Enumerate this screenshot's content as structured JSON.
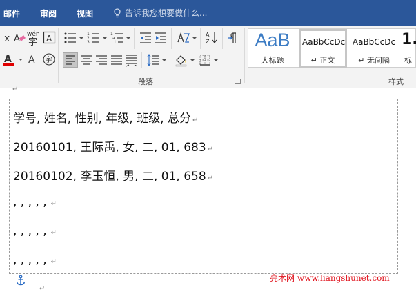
{
  "tabs": [
    {
      "label": "邮件"
    },
    {
      "label": "审阅"
    },
    {
      "label": "视图"
    }
  ],
  "tellme": {
    "placeholder": "告诉我您想要做什么..."
  },
  "ribbon": {
    "paragraph_group_label": "段落",
    "styles_group_label": "样式",
    "wen_glyph": "wén",
    "zi_glyph": "字",
    "A_glyph": "A",
    "az_glyph": "A↓Z"
  },
  "styles": [
    {
      "sample": "AaB",
      "name": "大标题"
    },
    {
      "sample": "AaBbCcDc",
      "name": "↵ 正文"
    },
    {
      "sample": "AaBbCcDc",
      "name": "↵ 无间隔"
    },
    {
      "sample": "1.",
      "name": "标"
    }
  ],
  "document": {
    "lines": [
      "学号, 姓名, 性别, 年级, 班级, 总分",
      "20160101, 王际禹, 女, 二, 01, 683",
      "20160102, 李玉恒, 男, 二, 01, 658",
      ", , , , ,",
      ", , , , ,",
      ", , , , ,"
    ],
    "paragraph_mark": "↵"
  },
  "watermark": "亮术网 www.liangshunet.com",
  "colors": {
    "tabbar": "#2b579a",
    "font_color_bar": "#e00000",
    "watermark": "#e0141e"
  }
}
